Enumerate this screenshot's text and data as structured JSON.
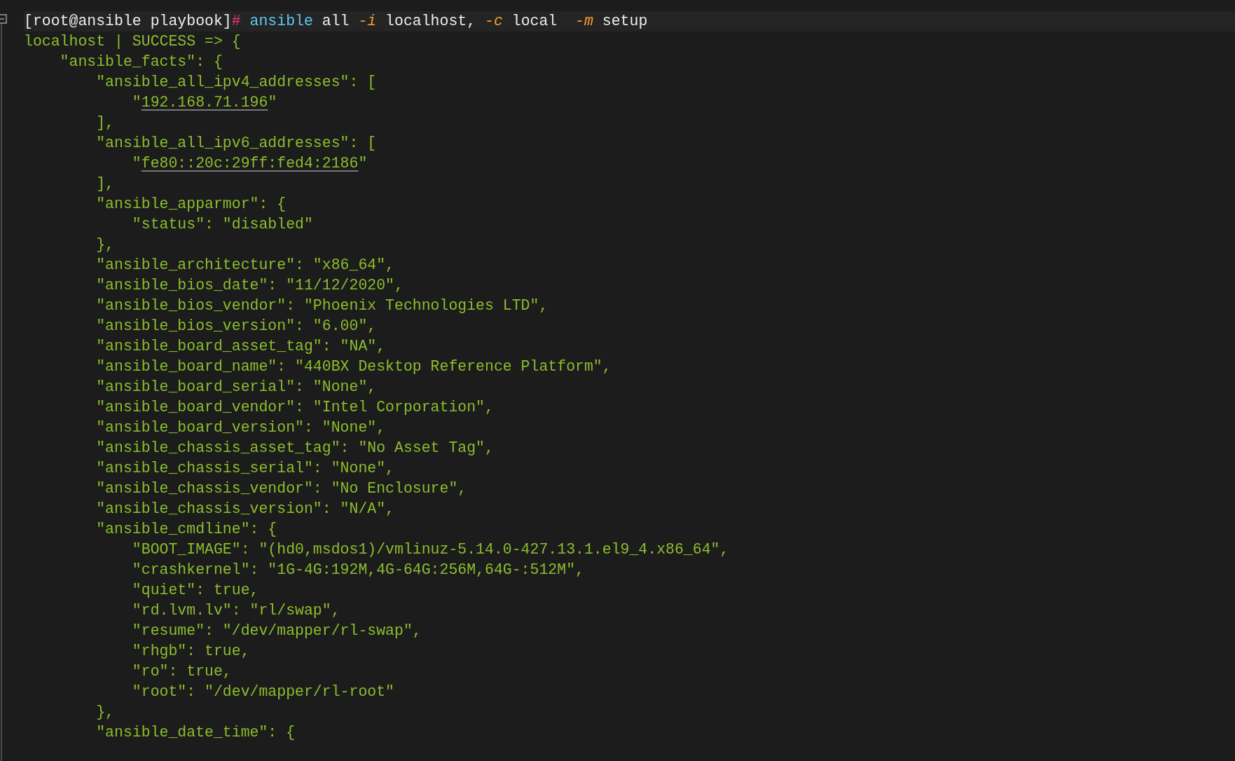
{
  "command": {
    "parts": [
      {
        "kind": "prompt",
        "text": "[root@ansible playbook]"
      },
      {
        "kind": "hash",
        "text": "#"
      },
      {
        "kind": "command",
        "text": " ansible"
      },
      {
        "kind": "plain",
        "text": " all "
      },
      {
        "kind": "flag",
        "text": "-i"
      },
      {
        "kind": "plain",
        "text": " localhost, "
      },
      {
        "kind": "flag",
        "text": "-c"
      },
      {
        "kind": "plain",
        "text": " local  "
      },
      {
        "kind": "flag",
        "text": "-m"
      },
      {
        "kind": "plain",
        "text": " setup"
      }
    ]
  },
  "output": [
    {
      "parts": [
        {
          "kind": "text",
          "text": "localhost | SUCCESS => {"
        }
      ]
    },
    {
      "parts": [
        {
          "kind": "text",
          "text": "    \"ansible_facts\": {"
        }
      ]
    },
    {
      "parts": [
        {
          "kind": "text",
          "text": "        \"ansible_all_ipv4_addresses\": ["
        }
      ]
    },
    {
      "parts": [
        {
          "kind": "text",
          "text": "            \""
        },
        {
          "kind": "link",
          "text": "192.168.71.196"
        },
        {
          "kind": "text",
          "text": "\""
        }
      ]
    },
    {
      "parts": [
        {
          "kind": "text",
          "text": "        ],"
        }
      ]
    },
    {
      "parts": [
        {
          "kind": "text",
          "text": "        \"ansible_all_ipv6_addresses\": ["
        }
      ]
    },
    {
      "parts": [
        {
          "kind": "text",
          "text": "            \""
        },
        {
          "kind": "link",
          "text": "fe80::20c:29ff:fed4:2186"
        },
        {
          "kind": "text",
          "text": "\""
        }
      ]
    },
    {
      "parts": [
        {
          "kind": "text",
          "text": "        ],"
        }
      ]
    },
    {
      "parts": [
        {
          "kind": "text",
          "text": "        \"ansible_apparmor\": {"
        }
      ]
    },
    {
      "parts": [
        {
          "kind": "text",
          "text": "            \"status\": \"disabled\""
        }
      ]
    },
    {
      "parts": [
        {
          "kind": "text",
          "text": "        },"
        }
      ]
    },
    {
      "parts": [
        {
          "kind": "text",
          "text": "        \"ansible_architecture\": \"x86_64\","
        }
      ]
    },
    {
      "parts": [
        {
          "kind": "text",
          "text": "        \"ansible_bios_date\": \"11/12/2020\","
        }
      ]
    },
    {
      "parts": [
        {
          "kind": "text",
          "text": "        \"ansible_bios_vendor\": \"Phoenix Technologies LTD\","
        }
      ]
    },
    {
      "parts": [
        {
          "kind": "text",
          "text": "        \"ansible_bios_version\": \"6.00\","
        }
      ]
    },
    {
      "parts": [
        {
          "kind": "text",
          "text": "        \"ansible_board_asset_tag\": \"NA\","
        }
      ]
    },
    {
      "parts": [
        {
          "kind": "text",
          "text": "        \"ansible_board_name\": \"440BX Desktop Reference Platform\","
        }
      ]
    },
    {
      "parts": [
        {
          "kind": "text",
          "text": "        \"ansible_board_serial\": \"None\","
        }
      ]
    },
    {
      "parts": [
        {
          "kind": "text",
          "text": "        \"ansible_board_vendor\": \"Intel Corporation\","
        }
      ]
    },
    {
      "parts": [
        {
          "kind": "text",
          "text": "        \"ansible_board_version\": \"None\","
        }
      ]
    },
    {
      "parts": [
        {
          "kind": "text",
          "text": "        \"ansible_chassis_asset_tag\": \"No Asset Tag\","
        }
      ]
    },
    {
      "parts": [
        {
          "kind": "text",
          "text": "        \"ansible_chassis_serial\": \"None\","
        }
      ]
    },
    {
      "parts": [
        {
          "kind": "text",
          "text": "        \"ansible_chassis_vendor\": \"No Enclosure\","
        }
      ]
    },
    {
      "parts": [
        {
          "kind": "text",
          "text": "        \"ansible_chassis_version\": \"N/A\","
        }
      ]
    },
    {
      "parts": [
        {
          "kind": "text",
          "text": "        \"ansible_cmdline\": {"
        }
      ]
    },
    {
      "parts": [
        {
          "kind": "text",
          "text": "            \"BOOT_IMAGE\": \"(hd0,msdos1)/vmlinuz-5.14.0-427.13.1.el9_4.x86_64\","
        }
      ]
    },
    {
      "parts": [
        {
          "kind": "text",
          "text": "            \"crashkernel\": \"1G-4G:192M,4G-64G:256M,64G-:512M\","
        }
      ]
    },
    {
      "parts": [
        {
          "kind": "text",
          "text": "            \"quiet\": true,"
        }
      ]
    },
    {
      "parts": [
        {
          "kind": "text",
          "text": "            \"rd.lvm.lv\": \"rl/swap\","
        }
      ]
    },
    {
      "parts": [
        {
          "kind": "text",
          "text": "            \"resume\": \"/dev/mapper/rl-swap\","
        }
      ]
    },
    {
      "parts": [
        {
          "kind": "text",
          "text": "            \"rhgb\": true,"
        }
      ]
    },
    {
      "parts": [
        {
          "kind": "text",
          "text": "            \"ro\": true,"
        }
      ]
    },
    {
      "parts": [
        {
          "kind": "text",
          "text": "            \"root\": \"/dev/mapper/rl-root\""
        }
      ]
    },
    {
      "parts": [
        {
          "kind": "text",
          "text": "        },"
        }
      ]
    },
    {
      "parts": [
        {
          "kind": "text",
          "text": "        \"ansible_date_time\": {"
        }
      ]
    }
  ]
}
